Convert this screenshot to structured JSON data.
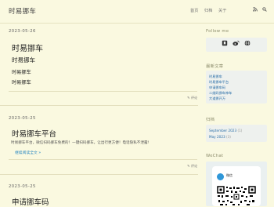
{
  "header": {
    "site_title": "时易挪车",
    "nav": [
      "首页",
      "归档",
      "关于"
    ],
    "icons": [
      "rss-icon",
      "search-icon"
    ]
  },
  "posts": [
    {
      "date": "2023-05-26",
      "title": "时易挪车",
      "body_lines": [
        "时易挪车",
        "时易挪车",
        "时易挪车"
      ],
      "comment": "评论"
    },
    {
      "date": "2023-05-25",
      "title": "时易挪车平台",
      "excerpt": "时易挪车平台，微信扫码挪车免费的！一键扫码挪车，让出行更方便！电话隐私不泄露!",
      "readmore": "继续阅读全文 »",
      "comment": "评论"
    },
    {
      "date": "2023-05-25",
      "title": "申请挪车码"
    }
  ],
  "sidebar": {
    "follow_title": "Follow me",
    "follow_icons": [
      "bookmark-icon",
      "weibo-icon",
      "globe-icon"
    ],
    "recent_title": "最新文章",
    "recent_posts": [
      "时易挪车",
      "时易挪车平台",
      "申请挪车码",
      "二维码挪车神车",
      "大道挪开万"
    ],
    "archive_title": "归档",
    "archives": [
      "September 2023",
      "May 2023"
    ],
    "archive_counts": [
      "(1)",
      "(3)"
    ],
    "wechat_title": "WeChat",
    "wechat_name": "微信"
  }
}
